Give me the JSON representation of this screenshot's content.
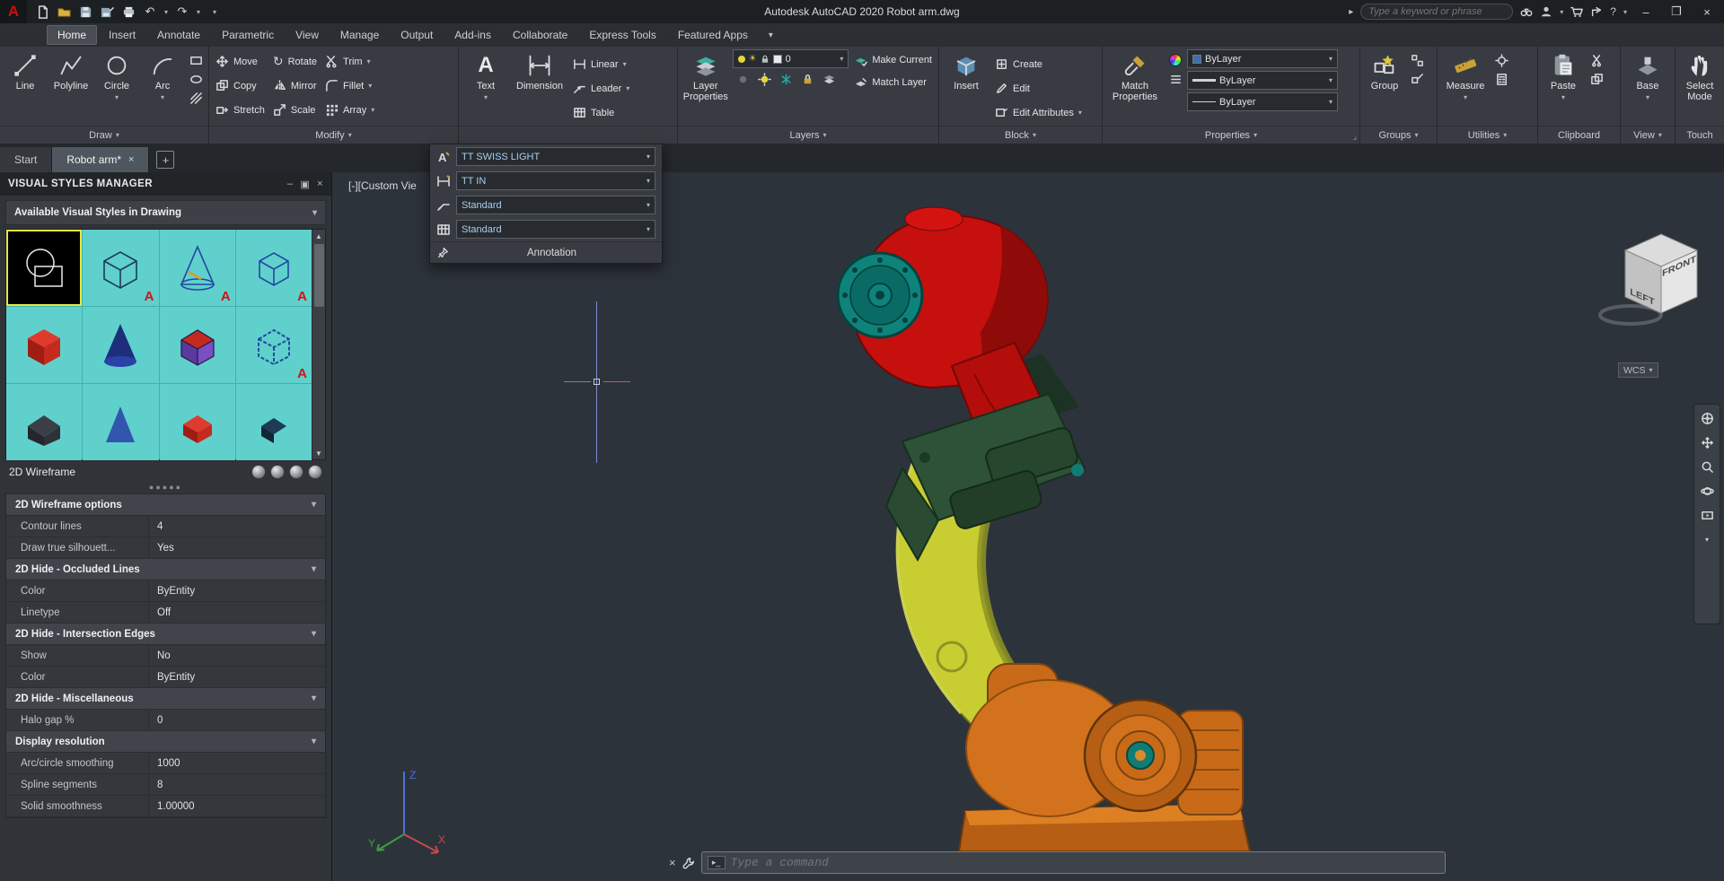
{
  "titlebar": {
    "app_title": "Autodesk AutoCAD 2020   Robot arm.dwg",
    "search_placeholder": "Type a keyword or phrase"
  },
  "ribbon": {
    "tabs": [
      "Home",
      "Insert",
      "Annotate",
      "Parametric",
      "View",
      "Manage",
      "Output",
      "Add-ins",
      "Collaborate",
      "Express Tools",
      "Featured Apps"
    ],
    "draw": {
      "label": "Draw",
      "line": "Line",
      "polyline": "Polyline",
      "circle": "Circle",
      "arc": "Arc"
    },
    "modify": {
      "label": "Modify",
      "move": "Move",
      "rotate": "Rotate",
      "trim": "Trim",
      "copy": "Copy",
      "mirror": "Mirror",
      "fillet": "Fillet",
      "stretch": "Stretch",
      "scale": "Scale",
      "array": "Array"
    },
    "annotation_panel": {
      "text": "Text",
      "dimension": "Dimension",
      "linear": "Linear",
      "leader": "Leader",
      "table": "Table"
    },
    "layers": {
      "label": "Layers",
      "big": "Layer Properties",
      "current_layer": "0",
      "make_current": "Make Current",
      "match_layer": "Match Layer"
    },
    "block": {
      "label": "Block",
      "insert": "Insert",
      "create": "Create",
      "edit": "Edit",
      "edit_attributes": "Edit Attributes"
    },
    "properties": {
      "label": "Properties",
      "match_properties": "Match Properties",
      "color": "ByLayer",
      "lineweight": "ByLayer",
      "linetype": "ByLayer"
    },
    "groups": {
      "label": "Groups",
      "group": "Group"
    },
    "utilities": {
      "label": "Utilities",
      "measure": "Measure"
    },
    "clipboard": {
      "label": "Clipboard",
      "paste": "Paste"
    },
    "view": {
      "label": "View",
      "base": "Base"
    },
    "touch": {
      "label": "Touch",
      "select_mode": "Select Mode"
    }
  },
  "annotation_flyout": {
    "text_style": "TT SWISS LIGHT",
    "dim_style": "TT IN",
    "leader_style": "Standard",
    "table_style": "Standard",
    "panel_label": "Annotation"
  },
  "file_tabs": {
    "start": "Start",
    "active": "Robot arm*"
  },
  "palette": {
    "title": "VISUAL STYLES MANAGER",
    "header": "Available Visual Styles in Drawing",
    "selected_style": "2D Wireframe",
    "sections": [
      {
        "title": "2D Wireframe options",
        "rows": [
          {
            "label": "Contour lines",
            "value": "4"
          },
          {
            "label": "Draw true silhouett...",
            "value": "Yes"
          }
        ]
      },
      {
        "title": "2D Hide - Occluded Lines",
        "rows": [
          {
            "label": "Color",
            "value": "ByEntity"
          },
          {
            "label": "Linetype",
            "value": "Off"
          }
        ]
      },
      {
        "title": "2D Hide - Intersection Edges",
        "rows": [
          {
            "label": "Show",
            "value": "No"
          },
          {
            "label": "Color",
            "value": "ByEntity"
          }
        ]
      },
      {
        "title": "2D Hide - Miscellaneous",
        "rows": [
          {
            "label": "Halo gap %",
            "value": "0"
          }
        ]
      },
      {
        "title": "Display resolution",
        "rows": [
          {
            "label": "Arc/circle smoothing",
            "value": "1000"
          },
          {
            "label": "Spline segments",
            "value": "8"
          },
          {
            "label": "Solid smoothness",
            "value": "1.00000"
          }
        ]
      }
    ]
  },
  "viewport": {
    "label": "[-][Custom Vie",
    "wcs": "WCS",
    "viewcube_left": "LEFT",
    "viewcube_front": "FRONT",
    "ucs_x": "X",
    "ucs_y": "Y",
    "ucs_z": "Z"
  },
  "command": {
    "placeholder": "Type a command"
  },
  "colors": {
    "accent_teal": "#0e837b",
    "model_red": "#c5100e",
    "model_yellow": "#c8cd31",
    "model_green": "#2e5237",
    "model_orange": "#d3721c",
    "thumb_bg": "#5fd0cc"
  }
}
